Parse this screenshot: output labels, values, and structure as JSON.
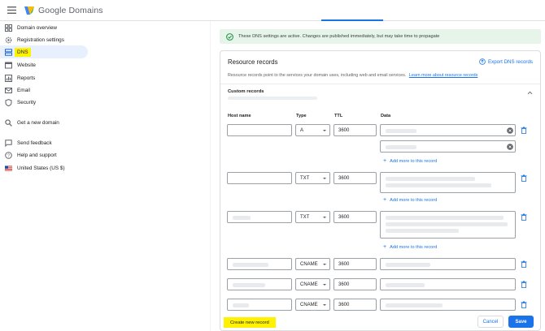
{
  "app": {
    "brand": "Google Domains"
  },
  "sidebar": {
    "items": [
      {
        "label": "Domain overview",
        "icon": "overview-icon"
      },
      {
        "label": "Registration settings",
        "icon": "settings-gear-icon"
      },
      {
        "label": "DNS",
        "icon": "dns-icon",
        "active": true
      },
      {
        "label": "Website",
        "icon": "website-icon"
      },
      {
        "label": "Reports",
        "icon": "reports-icon"
      },
      {
        "label": "Email",
        "icon": "email-icon"
      },
      {
        "label": "Security",
        "icon": "shield-icon"
      },
      {
        "label": "Get a new domain",
        "icon": "search-icon"
      },
      {
        "label": "Send feedback",
        "icon": "feedback-icon"
      },
      {
        "label": "Help and support",
        "icon": "help-icon"
      },
      {
        "label": "United States (US $)",
        "icon": "us-flag-icon"
      }
    ]
  },
  "banner": {
    "text": "These DNS settings are active. Changes are published immediately, but may take time to propagate"
  },
  "resource_records": {
    "title": "Resource records",
    "export_label": "Export DNS records",
    "description": "Resource records point to the services your domain uses, including web and email services.",
    "learn_more": "Learn more about resource records",
    "custom_title": "Custom records",
    "columns": {
      "host": "Host name",
      "type": "Type",
      "ttl": "TTL",
      "data": "Data"
    },
    "add_more_label": "Add more to this record",
    "rows": [
      {
        "type": "A",
        "ttl": "3600"
      },
      {
        "type": "TXT",
        "ttl": "3600"
      },
      {
        "type": "TXT",
        "ttl": "3600"
      },
      {
        "type": "CNAME",
        "ttl": "3600"
      },
      {
        "type": "CNAME",
        "ttl": "3600"
      },
      {
        "type": "CNAME",
        "ttl": "3600"
      }
    ]
  },
  "actions": {
    "create_label": "Create new record",
    "cancel_label": "Cancel",
    "save_label": "Save"
  },
  "colors": {
    "accent": "#1a73e8",
    "highlight": "#fff200",
    "success_bg": "#e6f4ea"
  }
}
